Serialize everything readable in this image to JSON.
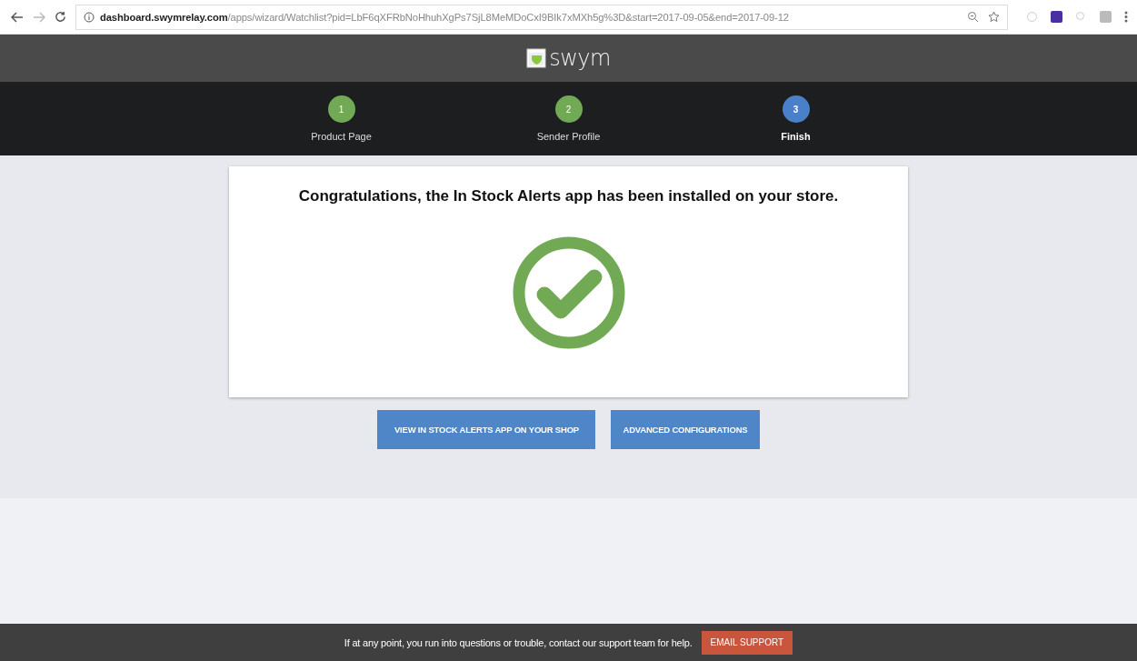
{
  "browser": {
    "url_host": "dashboard.swymrelay.com",
    "url_path": "/apps/wizard/Watchlist?pid=LbF6qXFRbNoHhuhXgPs7SjL8MeMDoCxI9BIk7xMXh5g%3D&start=2017-09-05&end=2017-09-12"
  },
  "header": {
    "logo_text": "swym"
  },
  "steps": [
    {
      "number": "1",
      "label": "Product Page",
      "selected": false
    },
    {
      "number": "2",
      "label": "Sender Profile",
      "selected": false
    },
    {
      "number": "3",
      "label": "Finish",
      "selected": true
    }
  ],
  "card": {
    "message": "Congratulations, the In Stock Alerts app has been installed on your store."
  },
  "buttons": [
    "VIEW IN STOCK ALERTS APP ON YOUR SHOP",
    "ADVANCED CONFIGURATIONS"
  ],
  "footer": {
    "text": "If at any point, you run into questions or trouble, contact our support team for help.",
    "button": "EMAIL SUPPORT"
  }
}
